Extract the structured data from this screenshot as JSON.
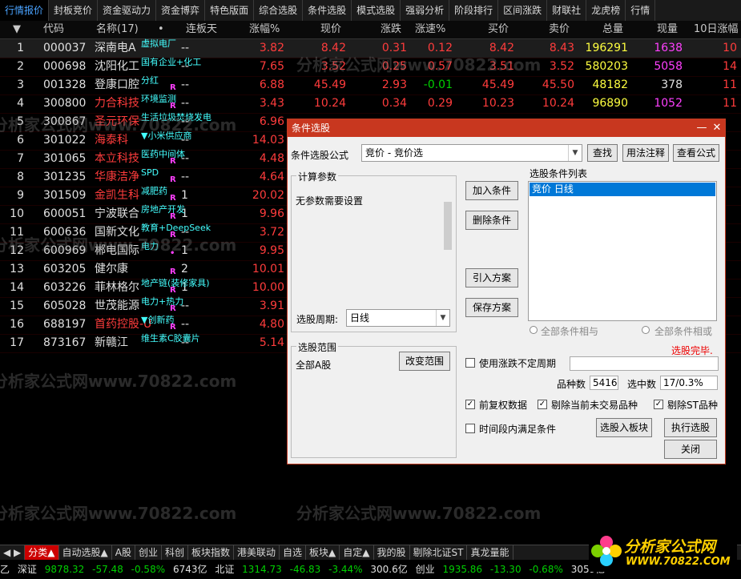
{
  "top_tabs": [
    "行情报价",
    "封板竞价",
    "资金驱动力",
    "资金博弈",
    "特色版面",
    "综合选股",
    "条件选股",
    "模式选股",
    "强弱分析",
    "阶段排行",
    "区间涨跌",
    "财联社",
    "龙虎榜",
    "行情"
  ],
  "columns": {
    "arrow": "▼",
    "code": "代码",
    "name": "名称(17)",
    "dot": "•",
    "lianban": "连板天",
    "zhangfu": "涨幅%",
    "xianjia": "现价",
    "zhangdie": "涨跌",
    "zhangsu": "涨速%",
    "mai": "买价",
    "maichu": "卖价",
    "zongliang": "总量",
    "xianliang": "现量",
    "shiri": "10日涨幅"
  },
  "rows": [
    {
      "n": "1",
      "code": "000037",
      "name": "深南电A",
      "tag": "虚拟电厂",
      "r": "",
      "lb": "--",
      "zf": "3.82",
      "xj": "8.42",
      "zd": "0.31",
      "zs": "0.12",
      "buy": "8.42",
      "sell": "8.43",
      "zl": "196291",
      "xl": "1638",
      "sr": "10",
      "nc": "wht",
      "zsc": "red",
      "xlc": "mag"
    },
    {
      "n": "2",
      "code": "000698",
      "name": "沈阳化工",
      "tag": "国有企业+化工",
      "r": "",
      "lb": "--",
      "zf": "7.65",
      "xj": "3.52",
      "zd": "0.25",
      "zs": "0.57",
      "buy": "3.51",
      "sell": "3.52",
      "zl": "580203",
      "xl": "5058",
      "sr": "14",
      "nc": "wht",
      "zsc": "red",
      "xlc": "mag"
    },
    {
      "n": "3",
      "code": "001328",
      "name": "登康口腔",
      "tag": "分红",
      "r": "R",
      "lb": "--",
      "zf": "6.88",
      "xj": "45.49",
      "zd": "2.93",
      "zs": "-0.01",
      "buy": "45.49",
      "sell": "45.50",
      "zl": "48182",
      "xl": "378",
      "sr": "11",
      "nc": "wht",
      "zsc": "grn",
      "xlc": "wht"
    },
    {
      "n": "4",
      "code": "300800",
      "name": "力合科技",
      "tag": "环境监测",
      "r": "R",
      "lb": "--",
      "zf": "3.43",
      "xj": "10.24",
      "zd": "0.34",
      "zs": "0.29",
      "buy": "10.23",
      "sell": "10.24",
      "zl": "96890",
      "xl": "1052",
      "sr": "11",
      "nc": "red",
      "zsc": "red",
      "xlc": "mag"
    },
    {
      "n": "5",
      "code": "300867",
      "name": "圣元环保",
      "tag": "生活垃圾焚烧发电",
      "r": "",
      "lb": "--",
      "zf": "6.96",
      "xj": "",
      "zd": "",
      "zs": "",
      "buy": "",
      "sell": "",
      "zl": "",
      "xl": "",
      "sr": "",
      "nc": "red",
      "zsc": "red",
      "xlc": "mag"
    },
    {
      "n": "6",
      "code": "301022",
      "name": "海泰科",
      "tag": "▼小米供应商",
      "r": "",
      "lb": "--",
      "zf": "14.03",
      "xj": "",
      "zd": "",
      "zs": "",
      "buy": "",
      "sell": "",
      "zl": "",
      "xl": "",
      "sr": "",
      "nc": "red",
      "zsc": "red",
      "xlc": "mag"
    },
    {
      "n": "7",
      "code": "301065",
      "name": "本立科技",
      "tag": "医药中间体",
      "r": "R",
      "lb": "--",
      "zf": "4.48",
      "xj": "",
      "zd": "",
      "zs": "",
      "buy": "",
      "sell": "",
      "zl": "",
      "xl": "",
      "sr": "",
      "nc": "red",
      "zsc": "red",
      "xlc": "mag"
    },
    {
      "n": "8",
      "code": "301235",
      "name": "华康洁净",
      "tag": "SPD",
      "r": "R",
      "lb": "--",
      "zf": "4.64",
      "xj": "",
      "zd": "",
      "zs": "",
      "buy": "",
      "sell": "",
      "zl": "",
      "xl": "",
      "sr": "",
      "nc": "red",
      "zsc": "red",
      "xlc": "mag"
    },
    {
      "n": "9",
      "code": "301509",
      "name": "金凯生科",
      "tag": "减肥药",
      "r": "R",
      "lb": "1",
      "zf": "20.02",
      "xj": "",
      "zd": "",
      "zs": "",
      "buy": "",
      "sell": "",
      "zl": "",
      "xl": "",
      "sr": "",
      "nc": "red",
      "zsc": "red",
      "xlc": "mag"
    },
    {
      "n": "10",
      "code": "600051",
      "name": "宁波联合",
      "tag": "房地产开发",
      "r": "R",
      "lb": "1",
      "zf": "9.96",
      "xj": "",
      "zd": "",
      "zs": "",
      "buy": "",
      "sell": "",
      "zl": "",
      "xl": "",
      "sr": "",
      "nc": "wht",
      "zsc": "red",
      "xlc": "mag"
    },
    {
      "n": "11",
      "code": "600636",
      "name": "国新文化",
      "tag": "教育+DeepSeek",
      "r": "R",
      "lb": "--",
      "zf": "3.72",
      "xj": "",
      "zd": "",
      "zs": "",
      "buy": "",
      "sell": "",
      "zl": "",
      "xl": "",
      "sr": "",
      "nc": "wht",
      "zsc": "red",
      "xlc": "mag"
    },
    {
      "n": "12",
      "code": "600969",
      "name": "郴电国际",
      "tag": "电力",
      "r": "•",
      "lb": "1",
      "zf": "9.95",
      "xj": "",
      "zd": "",
      "zs": "",
      "buy": "",
      "sell": "",
      "zl": "",
      "xl": "",
      "sr": "",
      "nc": "wht",
      "zsc": "red",
      "xlc": "mag"
    },
    {
      "n": "13",
      "code": "603205",
      "name": "健尔康",
      "tag": "",
      "r": "R",
      "lb": "2",
      "zf": "10.01",
      "xj": "",
      "zd": "",
      "zs": "",
      "buy": "",
      "sell": "",
      "zl": "",
      "xl": "",
      "sr": "",
      "nc": "wht",
      "zsc": "red",
      "xlc": "mag"
    },
    {
      "n": "14",
      "code": "603226",
      "name": "菲林格尔",
      "tag": "地产链(装修家具)",
      "r": "R",
      "lb": "1",
      "zf": "10.00",
      "xj": "",
      "zd": "",
      "zs": "",
      "buy": "",
      "sell": "",
      "zl": "",
      "xl": "",
      "sr": "",
      "nc": "wht",
      "zsc": "red",
      "xlc": "mag"
    },
    {
      "n": "15",
      "code": "605028",
      "name": "世茂能源",
      "tag": "电力+热力",
      "r": "R",
      "lb": "--",
      "zf": "3.91",
      "xj": "",
      "zd": "",
      "zs": "",
      "buy": "",
      "sell": "",
      "zl": "",
      "xl": "",
      "sr": "",
      "nc": "wht",
      "zsc": "red",
      "xlc": "mag"
    },
    {
      "n": "16",
      "code": "688197",
      "name": "首药控股-U",
      "tag": "▼创新药",
      "r": "R",
      "lb": "--",
      "zf": "4.80",
      "xj": "",
      "zd": "",
      "zs": "",
      "buy": "",
      "sell": "",
      "zl": "",
      "xl": "",
      "sr": "",
      "nc": "red",
      "zsc": "red",
      "xlc": "mag"
    },
    {
      "n": "17",
      "code": "873167",
      "name": "新赣江",
      "tag": "维生素C胶囊片",
      "r": "",
      "lb": "--",
      "zf": "5.14",
      "xj": "",
      "zd": "",
      "zs": "",
      "buy": "",
      "sell": "",
      "zl": "",
      "xl": "",
      "sr": "",
      "nc": "wht",
      "zsc": "red",
      "xlc": "mag"
    }
  ],
  "dialog": {
    "title": "条件选股",
    "min_icon": "—",
    "close_icon": "✕",
    "formula_label": "条件选股公式",
    "formula_value": "竞价 - 竞价选",
    "find_btn": "查找",
    "usage_btn": "用法注释",
    "view_btn": "查看公式",
    "calc_group": "计算参数",
    "no_params": "无参数需要设置",
    "add_btn": "加入条件",
    "del_btn": "删除条件",
    "cond_list_label": "选股条件列表",
    "cond_item": "竞价 日线",
    "import_btn": "引入方案",
    "save_btn": "保存方案",
    "period_label": "选股周期:",
    "period_value": "日线",
    "radio_and": "全部条件相与",
    "radio_or": "全部条件相或",
    "range_group": "选股范围",
    "range_value": "全部A股",
    "change_range_btn": "改变范围",
    "done_text": "选股完毕.",
    "use_zd_label": "使用涨跌不定周期",
    "count_label": "品种数",
    "count_value": "5416",
    "hit_label": "选中数",
    "hit_value": "17/0.3%",
    "pre_adj": "前复权数据",
    "remove_untrade": "剔除当前未交易品种",
    "remove_st": "剔除ST品种",
    "time_cond": "时间段内满足条件",
    "to_block_btn": "选股入板块",
    "exec_btn": "执行选股",
    "close_btn": "关闭"
  },
  "watermark": "分析家公式网www.70822.com",
  "bottom_tabs": [
    "分类▲",
    "自动选股▲",
    "A股",
    "创业",
    "科创",
    "板块指数",
    "港美联动",
    "自选",
    "板块▲",
    "自定▲",
    "我的股",
    "剔除北证ST",
    "真龙量能"
  ],
  "status": {
    "prefix": "乙",
    "sz_label": "深证",
    "sz_val": "9878.32",
    "sz_chg": "-57.48",
    "sz_pct": "-0.58%",
    "sz_amt": "6743亿",
    "bz_label": "北证",
    "bz_val": "1314.73",
    "bz_chg": "-46.83",
    "bz_pct": "-3.44%",
    "bz_amt": "300.6亿",
    "cy_label": "创业",
    "cy_val": "1935.86",
    "cy_chg": "-13.30",
    "cy_pct": "-0.68%",
    "cy_amt": "3059亿"
  },
  "logo": {
    "cn": "分析家公式网",
    "url": "WWW.70822.COM"
  }
}
